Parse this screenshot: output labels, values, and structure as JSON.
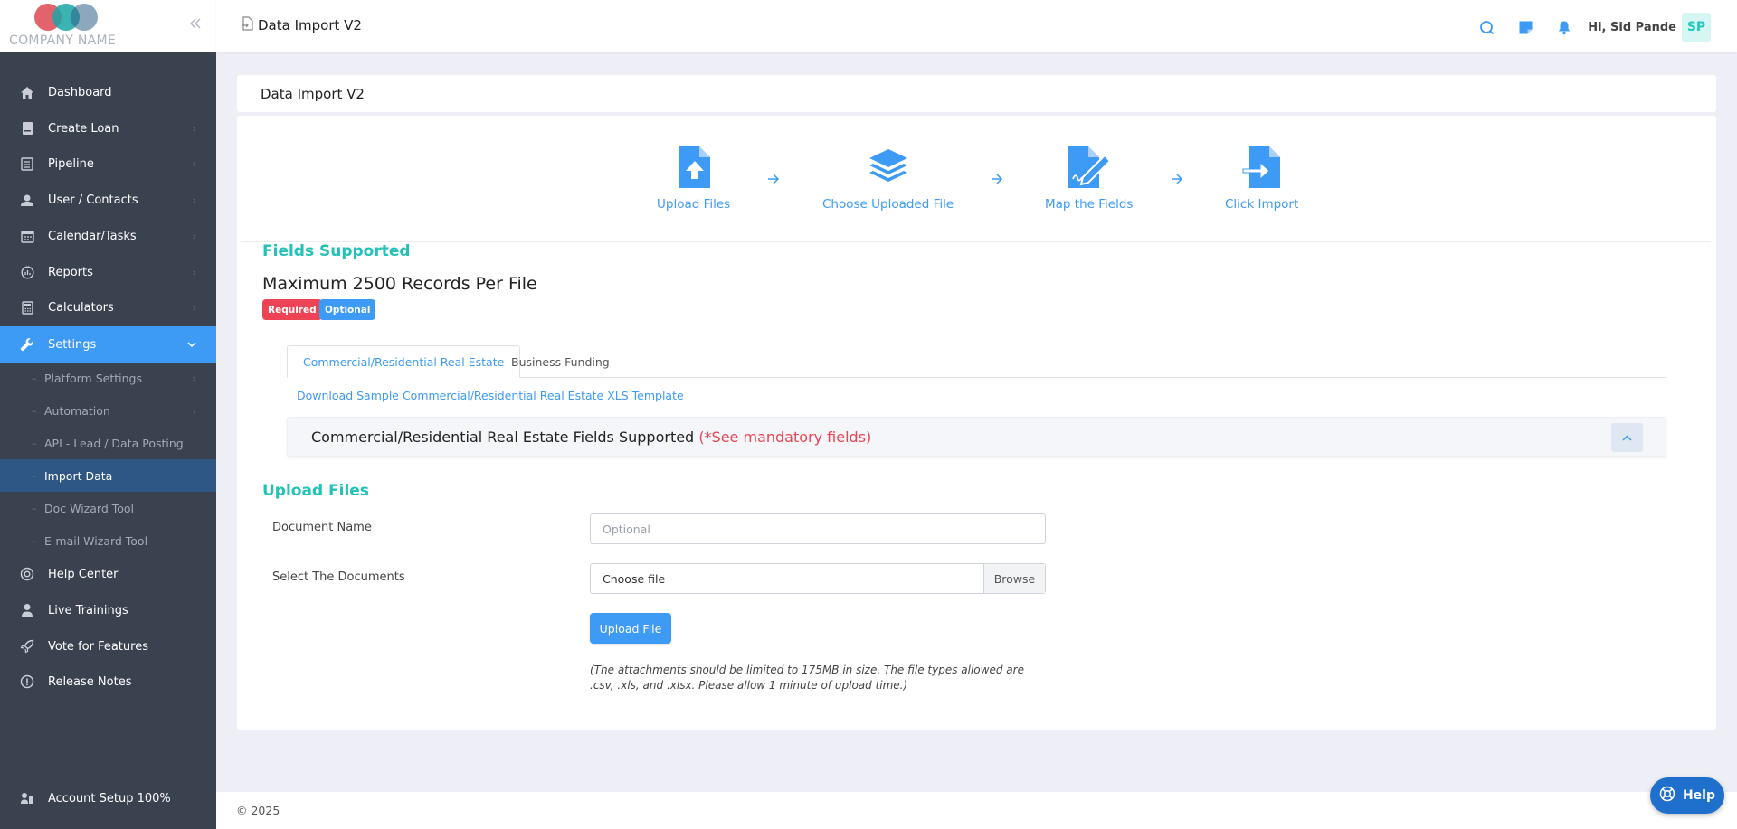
{
  "brand": {
    "logo_text": "COMPANY NAME",
    "colors": [
      "#e0525a",
      "#1aa6a6",
      "#2f5f8a"
    ]
  },
  "header": {
    "page_title": "Data Import V2",
    "greeting": "Hi, Sid Pande",
    "avatar_initials": "SP",
    "icons": [
      "search-icon",
      "sticky-note-icon",
      "bell-icon"
    ]
  },
  "sidebar": {
    "items": [
      {
        "label": "Dashboard",
        "icon": "home-icon",
        "chevron": false
      },
      {
        "label": "Create Loan",
        "icon": "document-icon",
        "chevron": true
      },
      {
        "label": "Pipeline",
        "icon": "list-icon",
        "chevron": true
      },
      {
        "label": "User / Contacts",
        "icon": "user-icon",
        "chevron": true
      },
      {
        "label": "Calendar/Tasks",
        "icon": "calendar-icon",
        "chevron": true
      },
      {
        "label": "Reports",
        "icon": "chart-icon",
        "chevron": true
      },
      {
        "label": "Calculators",
        "icon": "calculator-icon",
        "chevron": true
      },
      {
        "label": "Settings",
        "icon": "wrench-icon",
        "chevron": true,
        "active": true
      }
    ],
    "sub_items": [
      {
        "label": "Platform Settings",
        "chevron": true
      },
      {
        "label": "Automation",
        "chevron": true
      },
      {
        "label": "API - Lead / Data Posting",
        "chevron": false
      },
      {
        "label": "Import Data",
        "chevron": false,
        "active": true
      },
      {
        "label": "Doc Wizard Tool",
        "chevron": false
      },
      {
        "label": "E-mail Wizard Tool",
        "chevron": false
      }
    ],
    "bottom_items": [
      {
        "label": "Help Center",
        "icon": "lifebuoy-icon"
      },
      {
        "label": "Live Trainings",
        "icon": "person-icon"
      },
      {
        "label": "Vote for Features",
        "icon": "rocket-icon"
      },
      {
        "label": "Release Notes",
        "icon": "info-icon"
      }
    ],
    "account_setup": "Account Setup 100%"
  },
  "main": {
    "card_title": "Data Import V2",
    "steps": [
      {
        "label": "Upload Files",
        "icon": "file-upload-icon"
      },
      {
        "label": "Choose Uploaded File",
        "icon": "layers-icon"
      },
      {
        "label": "Map the Fields",
        "icon": "file-edit-icon"
      },
      {
        "label": "Click Import",
        "icon": "file-import-icon"
      }
    ],
    "fields_supported_title": "Fields Supported",
    "max_records": "Maximum 2500 Records Per File",
    "badges": {
      "required": "Required",
      "optional": "Optional",
      "required_color": "#ec4454",
      "optional_color": "#3d9af5"
    },
    "tabs": [
      {
        "label": "Commercial/Residential Real Estate",
        "active": true
      },
      {
        "label": "Business Funding",
        "active": false
      }
    ],
    "download_link": "Download Sample Commercial/Residential Real Estate XLS Template",
    "accordion": {
      "title": "Commercial/Residential Real Estate Fields Supported",
      "mandatory": "(*See mandatory fields)"
    },
    "upload_title": "Upload Files",
    "form": {
      "doc_name_label": "Document Name",
      "doc_name_placeholder": "Optional",
      "select_docs_label": "Select The Documents",
      "file_value": "Choose file",
      "browse_label": "Browse",
      "upload_button": "Upload File",
      "note": "(The attachments should be limited to 175MB in size. The file types allowed are .csv, .xls, and .xlsx. Please allow 1 minute of upload time.)"
    }
  },
  "footer": {
    "copyright": "© 2025"
  },
  "help_button": "Help"
}
